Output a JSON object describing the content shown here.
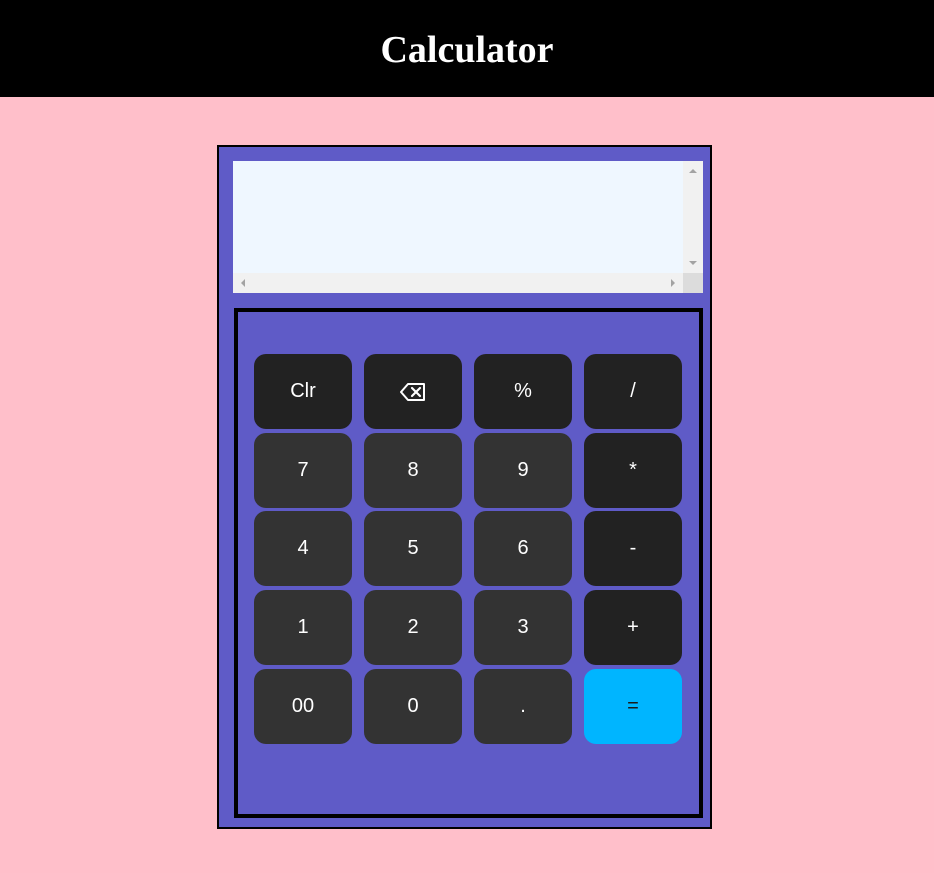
{
  "header": {
    "title": "Calculator"
  },
  "display": {
    "value": ""
  },
  "keys": {
    "clear": "Clr",
    "backspace_icon": "backspace-icon",
    "percent": "%",
    "divide": "/",
    "seven": "7",
    "eight": "8",
    "nine": "9",
    "multiply": "*",
    "four": "4",
    "five": "5",
    "six": "6",
    "minus": "-",
    "one": "1",
    "two": "2",
    "three": "3",
    "plus": "+",
    "double_zero": "00",
    "zero": "0",
    "decimal": ".",
    "equals": "="
  },
  "colors": {
    "page_background": "#ffbfca",
    "header_background": "#000000",
    "calculator_body": "#5f5bc7",
    "display_background": "#eff7ff",
    "operator_key": "#222222",
    "number_key": "#333333",
    "equals_key": "#00b5ff"
  }
}
